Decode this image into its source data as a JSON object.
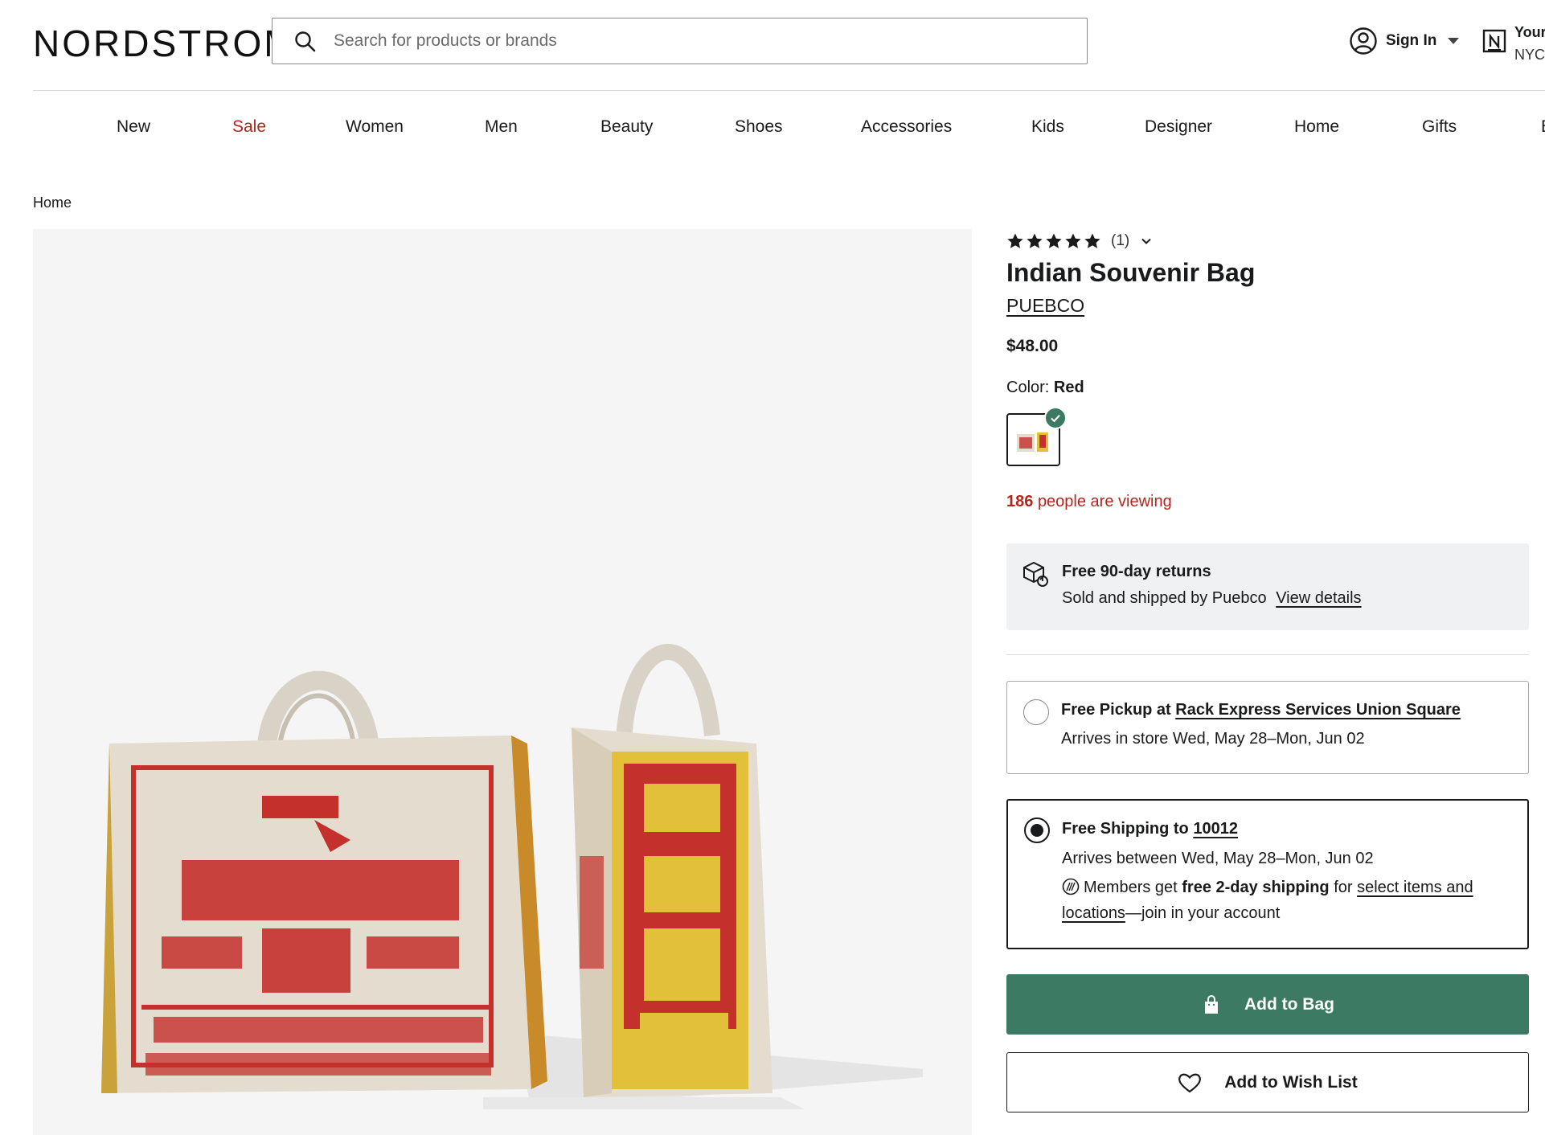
{
  "header": {
    "logo": "NORDSTROM",
    "search": {
      "placeholder": "Search for products or brands",
      "icon": "search-icon"
    },
    "sign_in": {
      "label": "Sign In",
      "icon": "account-icon"
    },
    "store": {
      "line1": "Your",
      "line2": "NYC",
      "icon": "store-icon"
    }
  },
  "nav": {
    "items": [
      {
        "label": "New"
      },
      {
        "label": "Sale",
        "color": "#b3261e"
      },
      {
        "label": "Women"
      },
      {
        "label": "Men"
      },
      {
        "label": "Beauty"
      },
      {
        "label": "Shoes"
      },
      {
        "label": "Accessories"
      },
      {
        "label": "Kids"
      },
      {
        "label": "Designer"
      },
      {
        "label": "Home"
      },
      {
        "label": "Gifts"
      },
      {
        "label": "B"
      }
    ]
  },
  "breadcrumb": {
    "label": "Home"
  },
  "product": {
    "rating_count": "(1)",
    "rating_stars": 5,
    "title": "Indian Souvenir Bag",
    "brand": "PUEBCO",
    "price": "$48.00",
    "color_label": "Color:",
    "color_value": "Red",
    "viewing_count": "186",
    "viewing_text": "people are viewing"
  },
  "returns": {
    "title": "Free 90-day returns",
    "sold_by": "Sold and shipped by Puebco",
    "link": "View details",
    "icon": "returns-box-icon"
  },
  "fulfillment": {
    "pickup": {
      "prefix": "Free Pickup at ",
      "store": "Rack Express Services Union Square",
      "arrival": "Arrives in store Wed, May 28–Mon, Jun 02",
      "selected": false
    },
    "shipping": {
      "prefix": "Free Shipping to ",
      "zip": "10012",
      "arrival": "Arrives between Wed, May 28–Mon, Jun 02",
      "members_prefix": "Members get ",
      "members_bold": "free 2-day shipping",
      "members_mid": " for ",
      "members_link": "select items and locations",
      "members_suffix": "—join in your account",
      "selected": true
    }
  },
  "actions": {
    "add_to_bag": "Add to Bag",
    "add_to_wish_list": "Add to Wish List"
  },
  "colors": {
    "accent_green": "#3d7a63",
    "sale_red": "#b3261e",
    "text": "#191a1b",
    "panel_gray": "#f0f1f2",
    "image_bg": "#f5f5f5"
  }
}
